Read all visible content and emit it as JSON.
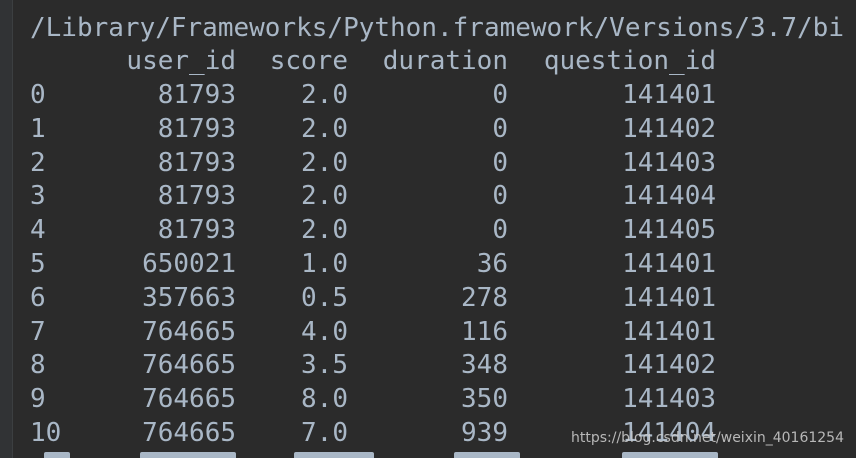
{
  "console": {
    "path": "/Library/Frameworks/Python.framework/Versions/3.7/bi",
    "columns": [
      "user_id",
      "score",
      "duration",
      "question_id"
    ],
    "rows": [
      {
        "index": "0",
        "user_id": "81793",
        "score": "2.0",
        "duration": "0",
        "question_id": "141401"
      },
      {
        "index": "1",
        "user_id": "81793",
        "score": "2.0",
        "duration": "0",
        "question_id": "141402"
      },
      {
        "index": "2",
        "user_id": "81793",
        "score": "2.0",
        "duration": "0",
        "question_id": "141403"
      },
      {
        "index": "3",
        "user_id": "81793",
        "score": "2.0",
        "duration": "0",
        "question_id": "141404"
      },
      {
        "index": "4",
        "user_id": "81793",
        "score": "2.0",
        "duration": "0",
        "question_id": "141405"
      },
      {
        "index": "5",
        "user_id": "650021",
        "score": "1.0",
        "duration": "36",
        "question_id": "141401"
      },
      {
        "index": "6",
        "user_id": "357663",
        "score": "0.5",
        "duration": "278",
        "question_id": "141401"
      },
      {
        "index": "7",
        "user_id": "764665",
        "score": "4.0",
        "duration": "116",
        "question_id": "141401"
      },
      {
        "index": "8",
        "user_id": "764665",
        "score": "3.5",
        "duration": "348",
        "question_id": "141402"
      },
      {
        "index": "9",
        "user_id": "764665",
        "score": "8.0",
        "duration": "350",
        "question_id": "141403"
      },
      {
        "index": "10",
        "user_id": "764665",
        "score": "7.0",
        "duration": "939",
        "question_id": "141404"
      }
    ]
  },
  "watermark": "https://blog.csdn.net/weixin_40161254",
  "colors": {
    "background": "#2b2b2b",
    "text": "#a9b7c6",
    "gutter": "#313335"
  }
}
